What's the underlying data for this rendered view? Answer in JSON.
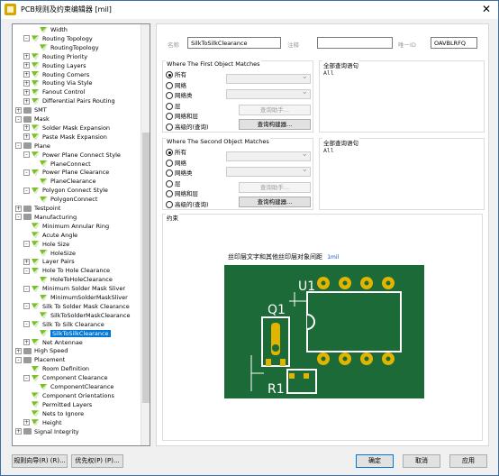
{
  "window": {
    "title": "PCB规则及约束编辑器 [mil]",
    "close_label": "✕"
  },
  "tree": {
    "items": [
      {
        "label": "Width",
        "indent": 3,
        "icon": "rule-icon",
        "expander": ""
      },
      {
        "label": "Routing Topology",
        "indent": 2,
        "icon": "rule-group-icon",
        "expander": "-"
      },
      {
        "label": "RoutingTopology",
        "indent": 3,
        "icon": "rule-icon",
        "expander": ""
      },
      {
        "label": "Routing Priority",
        "indent": 2,
        "icon": "rule-group-icon",
        "expander": "+"
      },
      {
        "label": "Routing Layers",
        "indent": 2,
        "icon": "rule-group-icon",
        "expander": "+"
      },
      {
        "label": "Routing Corners",
        "indent": 2,
        "icon": "rule-group-icon",
        "expander": "+"
      },
      {
        "label": "Routing Via Style",
        "indent": 2,
        "icon": "rule-group-icon",
        "expander": "+"
      },
      {
        "label": "Fanout Control",
        "indent": 2,
        "icon": "rule-group-icon",
        "expander": "+"
      },
      {
        "label": "Differential Pairs Routing",
        "indent": 2,
        "icon": "rule-group-icon",
        "expander": "+"
      },
      {
        "label": "SMT",
        "indent": 1,
        "icon": "category-icon",
        "expander": "+"
      },
      {
        "label": "Mask",
        "indent": 1,
        "icon": "category-icon",
        "expander": "-"
      },
      {
        "label": "Solder Mask Expansion",
        "indent": 2,
        "icon": "rule-group-icon",
        "expander": "+"
      },
      {
        "label": "Paste Mask Expansion",
        "indent": 2,
        "icon": "rule-group-icon",
        "expander": "+"
      },
      {
        "label": "Plane",
        "indent": 1,
        "icon": "category-icon",
        "expander": "-"
      },
      {
        "label": "Power Plane Connect Style",
        "indent": 2,
        "icon": "rule-group-icon",
        "expander": "-"
      },
      {
        "label": "PlaneConnect",
        "indent": 3,
        "icon": "rule-icon",
        "expander": ""
      },
      {
        "label": "Power Plane Clearance",
        "indent": 2,
        "icon": "rule-group-icon",
        "expander": "-"
      },
      {
        "label": "PlaneClearance",
        "indent": 3,
        "icon": "rule-icon",
        "expander": ""
      },
      {
        "label": "Polygon Connect Style",
        "indent": 2,
        "icon": "rule-group-icon",
        "expander": "-"
      },
      {
        "label": "PolygonConnect",
        "indent": 3,
        "icon": "rule-icon",
        "expander": ""
      },
      {
        "label": "Testpoint",
        "indent": 1,
        "icon": "category-icon",
        "expander": "+"
      },
      {
        "label": "Manufacturing",
        "indent": 1,
        "icon": "category-icon",
        "expander": "-"
      },
      {
        "label": "Minimum Annular Ring",
        "indent": 2,
        "icon": "rule-group-icon",
        "expander": ""
      },
      {
        "label": "Acute Angle",
        "indent": 2,
        "icon": "rule-group-icon",
        "expander": ""
      },
      {
        "label": "Hole Size",
        "indent": 2,
        "icon": "rule-group-icon",
        "expander": "-"
      },
      {
        "label": "HoleSize",
        "indent": 3,
        "icon": "rule-icon",
        "expander": ""
      },
      {
        "label": "Layer Pairs",
        "indent": 2,
        "icon": "rule-group-icon",
        "expander": "+"
      },
      {
        "label": "Hole To Hole Clearance",
        "indent": 2,
        "icon": "rule-group-icon",
        "expander": "-"
      },
      {
        "label": "HoleToHoleClearance",
        "indent": 3,
        "icon": "rule-icon",
        "expander": ""
      },
      {
        "label": "Minimum Solder Mask Sliver",
        "indent": 2,
        "icon": "rule-group-icon",
        "expander": "-"
      },
      {
        "label": "MinimumSolderMaskSliver",
        "indent": 3,
        "icon": "rule-icon",
        "expander": ""
      },
      {
        "label": "Silk To Solder Mask Clearance",
        "indent": 2,
        "icon": "rule-group-icon",
        "expander": "-"
      },
      {
        "label": "SilkToSolderMaskClearance",
        "indent": 3,
        "icon": "rule-icon",
        "expander": ""
      },
      {
        "label": "Silk To Silk Clearance",
        "indent": 2,
        "icon": "rule-group-icon",
        "expander": "-"
      },
      {
        "label": "SilkToSilkClearance",
        "indent": 3,
        "icon": "rule-icon",
        "expander": "",
        "selected": true
      },
      {
        "label": "Net Antennae",
        "indent": 2,
        "icon": "rule-group-icon",
        "expander": "+"
      },
      {
        "label": "High Speed",
        "indent": 1,
        "icon": "category-icon",
        "expander": "+"
      },
      {
        "label": "Placement",
        "indent": 1,
        "icon": "category-icon",
        "expander": "-"
      },
      {
        "label": "Room Definition",
        "indent": 2,
        "icon": "rule-group-icon",
        "expander": ""
      },
      {
        "label": "Component Clearance",
        "indent": 2,
        "icon": "rule-group-icon",
        "expander": "-"
      },
      {
        "label": "ComponentClearance",
        "indent": 3,
        "icon": "rule-icon",
        "expander": ""
      },
      {
        "label": "Component Orientations",
        "indent": 2,
        "icon": "rule-group-icon",
        "expander": ""
      },
      {
        "label": "Permitted Layers",
        "indent": 2,
        "icon": "rule-group-icon",
        "expander": ""
      },
      {
        "label": "Nets to Ignore",
        "indent": 2,
        "icon": "rule-group-icon",
        "expander": ""
      },
      {
        "label": "Height",
        "indent": 2,
        "icon": "rule-group-icon",
        "expander": "+"
      },
      {
        "label": "Signal Integrity",
        "indent": 1,
        "icon": "category-icon",
        "expander": "+"
      }
    ]
  },
  "rule": {
    "name_label": "名称",
    "name_value": "SilkToSilkClearance",
    "comment_label": "注释",
    "comment_value": "",
    "id_label": "唯一ID",
    "id_value": "OAVBLRFQ"
  },
  "first_object": {
    "title": "Where The First Object Matches",
    "options": [
      "所有",
      "网络",
      "网络类",
      "层",
      "网络和层",
      "高级的(查询)"
    ],
    "selected_index": 0,
    "helper_label": "查询助手...",
    "builder_label": "查询构建器...",
    "query_title": "全部查询语句",
    "query_text": "All"
  },
  "second_object": {
    "title": "Where The Second Object Matches",
    "options": [
      "所有",
      "网络",
      "网络类",
      "层",
      "网络和层",
      "高级的(查询)"
    ],
    "selected_index": 0,
    "helper_label": "查询助手...",
    "builder_label": "查询构建器...",
    "query_title": "全部查询语句",
    "query_text": "All"
  },
  "constraints": {
    "title": "约束",
    "caption": "丝印层文字和其他丝印层对象间距",
    "value": "1mil",
    "label_q1": "Q1",
    "label_u1": "U1",
    "label_r1": "R1",
    "colors": {
      "board": "#1c6a37",
      "silk": "#ffffff",
      "pad": "#e1b400"
    }
  },
  "footer": {
    "wizard_label": "规则向导(R) (R)...",
    "priority_label": "优先权(P) (P)...",
    "ok_label": "确定",
    "cancel_label": "取消",
    "apply_label": "应用"
  }
}
